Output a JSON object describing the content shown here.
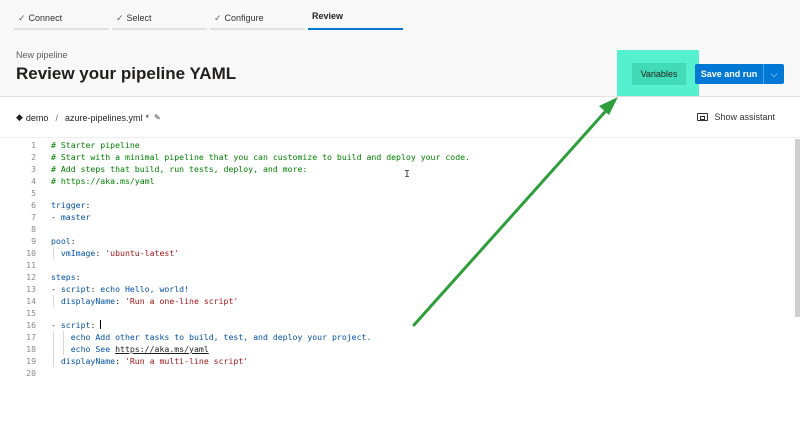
{
  "wizard": {
    "steps": [
      {
        "label": "Connect",
        "done": true
      },
      {
        "label": "Select",
        "done": true
      },
      {
        "label": "Configure",
        "done": true
      },
      {
        "label": "Review",
        "done": false
      }
    ],
    "check_glyph": "✓"
  },
  "header": {
    "subtitle": "New pipeline",
    "title": "Review your pipeline YAML",
    "variables_label": "Variables",
    "run_label": "Save and run",
    "run_dropdown_glyph": "⌵"
  },
  "file": {
    "repo": "demo",
    "separator": "/",
    "filename": "azure-pipelines.yml",
    "modified_marker": "*",
    "rename_glyph": "✎",
    "repo_glyph": "◆",
    "assistant_label": "Show assistant"
  },
  "editor": {
    "lines": [
      {
        "n": "1",
        "segs": [
          {
            "t": "# Starter pipeline",
            "c": "comment"
          }
        ]
      },
      {
        "n": "2",
        "segs": [
          {
            "t": "# Start with a minimal pipeline that you can customize to build and deploy your code.",
            "c": "comment"
          }
        ]
      },
      {
        "n": "3",
        "segs": [
          {
            "t": "# Add steps that build, run tests, deploy, and more:",
            "c": "comment"
          }
        ]
      },
      {
        "n": "4",
        "segs": [
          {
            "t": "# https://aka.ms/yaml",
            "c": "comment"
          }
        ]
      },
      {
        "n": "5",
        "segs": []
      },
      {
        "n": "6",
        "segs": [
          {
            "t": "trigger",
            "c": "key"
          },
          {
            "t": ":",
            "c": "plain"
          }
        ]
      },
      {
        "n": "7",
        "segs": [
          {
            "t": "- ",
            "c": "plain"
          },
          {
            "t": "master",
            "c": "key"
          }
        ]
      },
      {
        "n": "8",
        "segs": []
      },
      {
        "n": "9",
        "segs": [
          {
            "t": "pool",
            "c": "key"
          },
          {
            "t": ":",
            "c": "plain"
          }
        ]
      },
      {
        "n": "10",
        "segs": [
          {
            "t": "  vmImage",
            "c": "key"
          },
          {
            "t": ": ",
            "c": "plain"
          },
          {
            "t": "'ubuntu-latest'",
            "c": "str"
          }
        ]
      },
      {
        "n": "11",
        "segs": []
      },
      {
        "n": "12",
        "segs": [
          {
            "t": "steps",
            "c": "key"
          },
          {
            "t": ":",
            "c": "plain"
          }
        ]
      },
      {
        "n": "13",
        "segs": [
          {
            "t": "- ",
            "c": "plain"
          },
          {
            "t": "script",
            "c": "key"
          },
          {
            "t": ": ",
            "c": "plain"
          },
          {
            "t": "echo Hello, world!",
            "c": "key"
          }
        ]
      },
      {
        "n": "14",
        "segs": [
          {
            "t": "  displayName",
            "c": "key"
          },
          {
            "t": ": ",
            "c": "plain"
          },
          {
            "t": "'Run a one-line script'",
            "c": "str"
          }
        ]
      },
      {
        "n": "15",
        "segs": []
      },
      {
        "n": "16",
        "segs": [
          {
            "t": "- ",
            "c": "plain"
          },
          {
            "t": "script",
            "c": "key"
          },
          {
            "t": ": ",
            "c": "plain"
          },
          {
            "t": "",
            "c": "cursor"
          }
        ]
      },
      {
        "n": "17",
        "segs": [
          {
            "t": "    echo Add other tasks to build, test, and deploy your project.",
            "c": "key"
          }
        ]
      },
      {
        "n": "18",
        "segs": [
          {
            "t": "    echo See ",
            "c": "key"
          },
          {
            "t": "https://aka.ms/yaml",
            "c": "plain ul"
          }
        ]
      },
      {
        "n": "19",
        "segs": [
          {
            "t": "  displayName",
            "c": "key"
          },
          {
            "t": ": ",
            "c": "plain"
          },
          {
            "t": "'Run a multi-line script'",
            "c": "str"
          }
        ]
      },
      {
        "n": "20",
        "segs": []
      }
    ],
    "ibeam_glyph": "I"
  },
  "colors": {
    "accent": "#0078d4",
    "highlight": "#54f0cf",
    "annotation_arrow": "#2e9e3c"
  }
}
